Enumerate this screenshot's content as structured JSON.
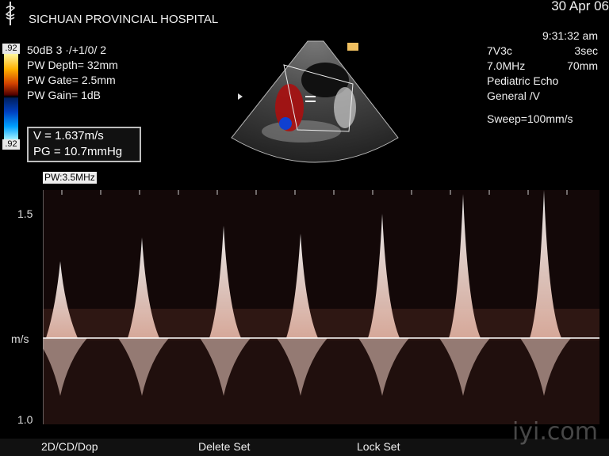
{
  "header": {
    "hospital": "SICHUAN PROVINCIAL HOSPITAL",
    "date": "30 Apr 06"
  },
  "params": {
    "line1": "50dB  3 ·/+1/0/ 2",
    "line2": "PW Depth=  32mm",
    "line3": "PW Gate=  2.5mm",
    "line4": "PW Gain=    1dB"
  },
  "right_info": {
    "time": "9:31:32 am",
    "probe": "7V3c",
    "persist": "3sec",
    "freq": "7.0MHz",
    "depth": "70mm",
    "preset": "Pediatric Echo",
    "mode": "General /V",
    "sweep": "Sweep=100mm/s"
  },
  "colorbar": {
    "top_label": ".92",
    "bottom_label": ".92"
  },
  "measurement": {
    "velocity": "V = 1.637m/s",
    "gradient": "PG = 10.7mmHg"
  },
  "spectral": {
    "pw_label": "PW:3.5MHz",
    "scale_top": "1.5",
    "scale_unit": "m/s",
    "scale_bottom": "1.0"
  },
  "bottom_bar": {
    "mode_keys": "2D/CD/Dop",
    "delete_set": "Delete Set",
    "lock_set": "Lock Set"
  },
  "watermark": "iyi.com",
  "colors": {
    "doppler": "#f4d4c8",
    "baseline": "#ffffff",
    "label_bg": "#e8e8e8"
  }
}
